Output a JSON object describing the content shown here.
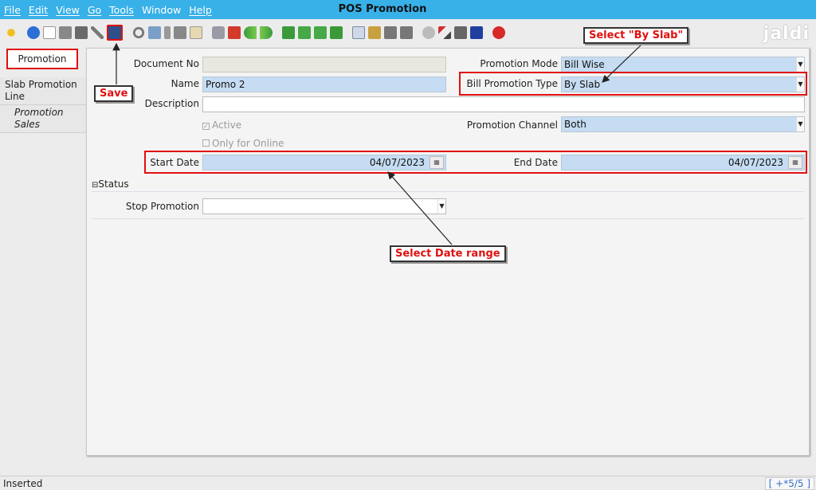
{
  "window": {
    "title": "POS Promotion"
  },
  "menu": [
    {
      "label": "File",
      "underline": true
    },
    {
      "label": "Edit",
      "underline": true
    },
    {
      "label": "View",
      "underline": true
    },
    {
      "label": "Go",
      "underline": true
    },
    {
      "label": "Tools",
      "underline": true
    },
    {
      "label": "Window",
      "underline": false
    },
    {
      "label": "Help",
      "underline": true
    }
  ],
  "brand": {
    "logo_text": "jaldi"
  },
  "tabs": {
    "promotion": "Promotion",
    "slab_promotion_line": "Slab Promotion Line",
    "promotion_sales": "Promotion Sales"
  },
  "form": {
    "document_no": {
      "label": "Document No",
      "value": ""
    },
    "name": {
      "label": "Name",
      "value": "Promo 2"
    },
    "description": {
      "label": "Description",
      "value": ""
    },
    "active": {
      "label": "Active",
      "checked": true
    },
    "only_online": {
      "label": "Only for Online",
      "checked": false
    },
    "start_date": {
      "label": "Start Date",
      "value": "04/07/2023"
    },
    "end_date": {
      "label": "End Date",
      "value": "04/07/2023"
    },
    "promotion_mode": {
      "label": "Promotion Mode",
      "value": "Bill Wise"
    },
    "bill_promotion_type": {
      "label": "Bill Promotion Type",
      "value": "By Slab"
    },
    "promotion_channel": {
      "label": "Promotion Channel",
      "value": "Both"
    },
    "status_section": "Status",
    "stop_promotion": {
      "label": "Stop Promotion",
      "value": ""
    }
  },
  "annotations": {
    "save": "Save",
    "select_by_slab": "Select \"By Slab\"",
    "select_date_range": "Select Date range"
  },
  "status": {
    "text": "Inserted",
    "record": "[ +*5/5 ]"
  },
  "colors": {
    "menubar": "#38b0e8",
    "field": "#c5dcf2",
    "annotation": "#e01010"
  }
}
